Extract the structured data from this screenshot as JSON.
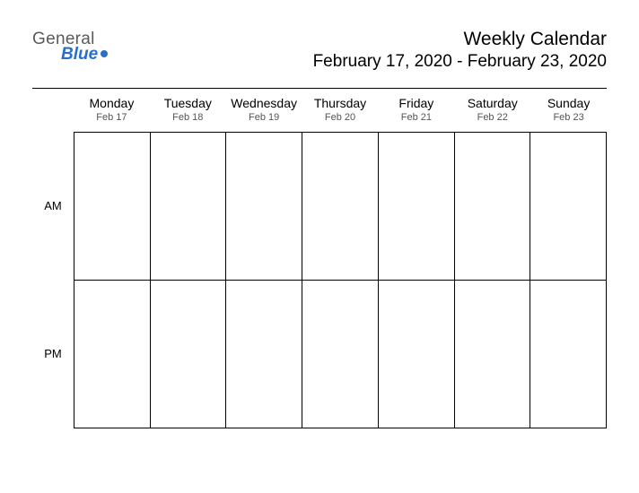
{
  "logo": {
    "line1": "General",
    "line2": "Blue"
  },
  "header": {
    "title": "Weekly Calendar",
    "subtitle": "February 17, 2020 - February 23, 2020"
  },
  "days": [
    {
      "name": "Monday",
      "date": "Feb 17"
    },
    {
      "name": "Tuesday",
      "date": "Feb 18"
    },
    {
      "name": "Wednesday",
      "date": "Feb 19"
    },
    {
      "name": "Thursday",
      "date": "Feb 20"
    },
    {
      "name": "Friday",
      "date": "Feb 21"
    },
    {
      "name": "Saturday",
      "date": "Feb 22"
    },
    {
      "name": "Sunday",
      "date": "Feb 23"
    }
  ],
  "periods": [
    "AM",
    "PM"
  ]
}
